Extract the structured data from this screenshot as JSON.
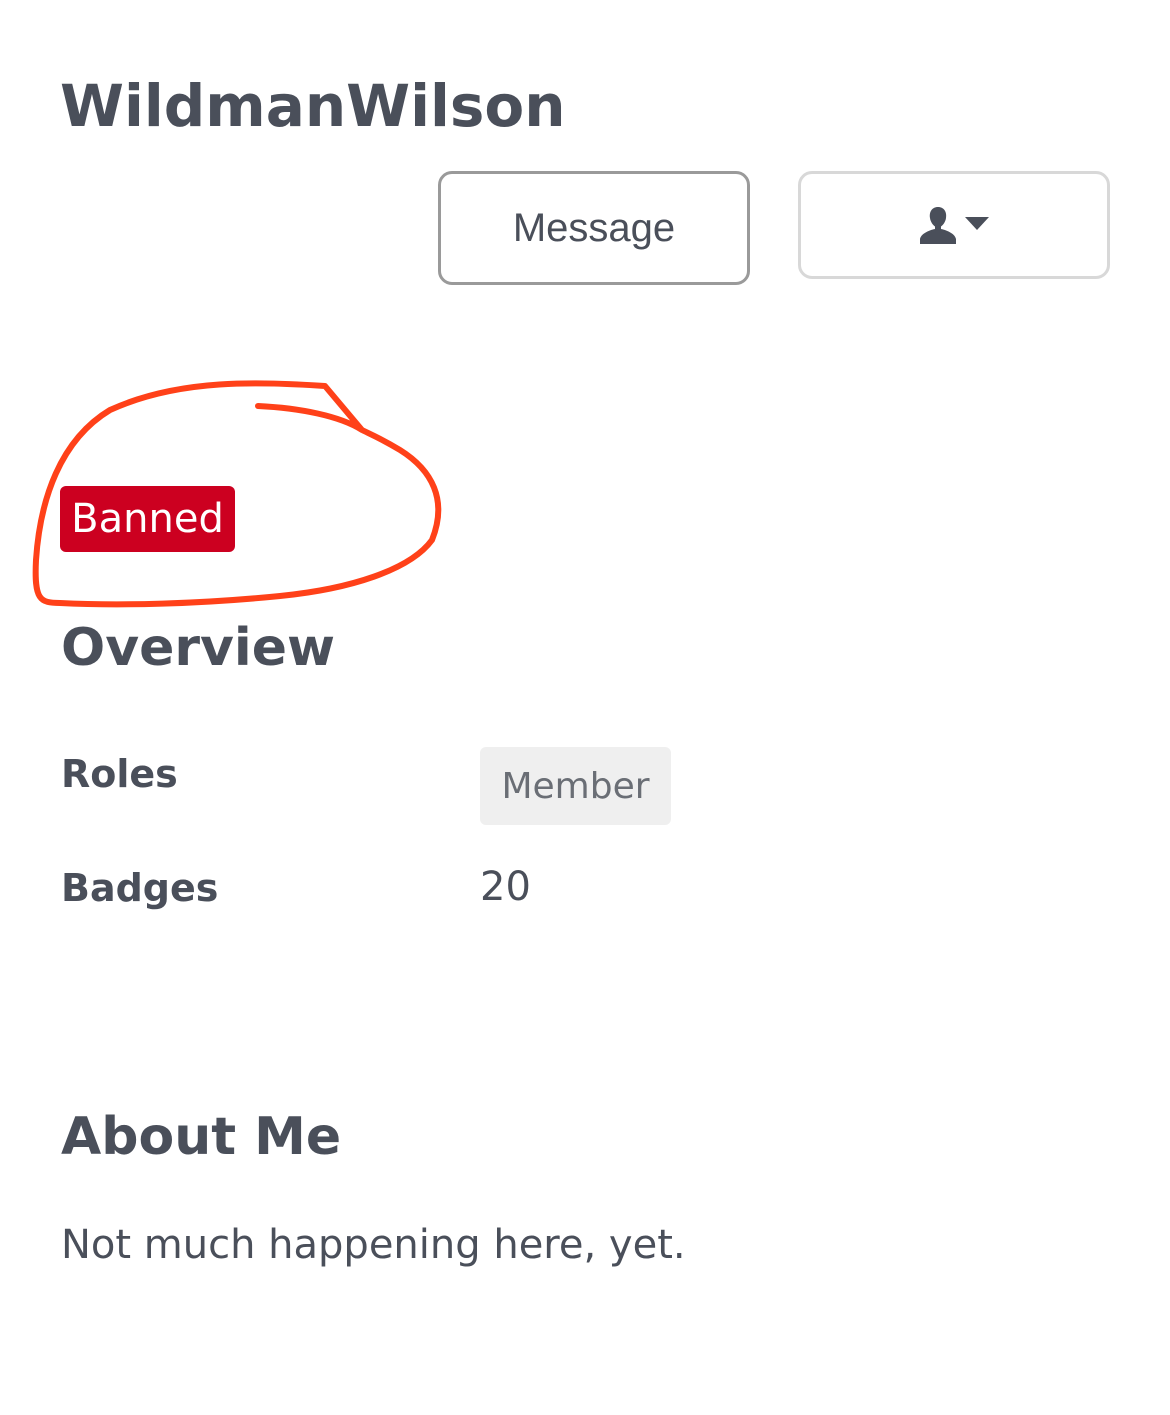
{
  "profile": {
    "username": "WildmanWilson",
    "status_badge": "Banned",
    "status_badge_color": "#cc0020",
    "annotation_color": "#ff4119"
  },
  "actions": {
    "message_label": "Message",
    "user_menu_icon": "user-icon",
    "user_menu_caret": "caret-down-icon"
  },
  "overview": {
    "title": "Overview",
    "roles_label": "Roles",
    "roles_value": "Member",
    "badges_label": "Badges",
    "badges_value": "20"
  },
  "about": {
    "title": "About Me",
    "text": "Not much happening here, yet."
  }
}
